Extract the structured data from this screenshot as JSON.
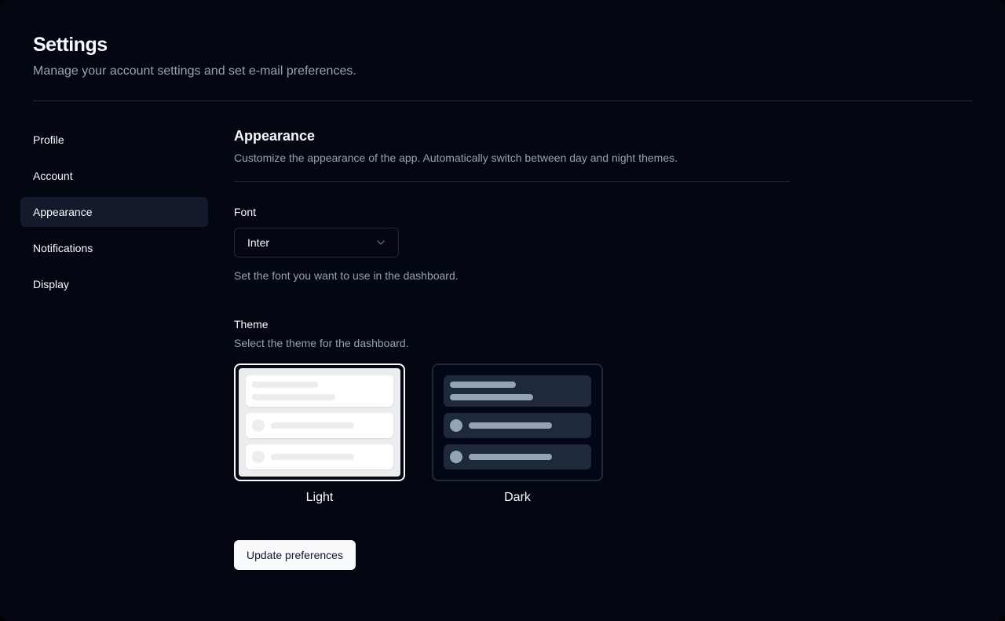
{
  "page": {
    "title": "Settings",
    "subtitle": "Manage your account settings and set e-mail preferences."
  },
  "sidebar": {
    "items": [
      {
        "label": "Profile",
        "active": false
      },
      {
        "label": "Account",
        "active": false
      },
      {
        "label": "Appearance",
        "active": true
      },
      {
        "label": "Notifications",
        "active": false
      },
      {
        "label": "Display",
        "active": false
      }
    ]
  },
  "main": {
    "heading": "Appearance",
    "description": "Customize the appearance of the app. Automatically switch between day and night themes.",
    "font_field": {
      "label": "Font",
      "value": "Inter",
      "helper": "Set the font you want to use in the dashboard.",
      "icon": "chevron-down"
    },
    "theme_field": {
      "label": "Theme",
      "description": "Select the theme for the dashboard.",
      "options": [
        {
          "label": "Light",
          "selected": true
        },
        {
          "label": "Dark",
          "selected": false
        }
      ]
    },
    "submit_label": "Update preferences"
  },
  "colors": {
    "page_bg": "#030711",
    "text": "#f8fafc",
    "muted_text": "#94a3b8",
    "border": "#1e293b",
    "active_item_bg": "#131a2b",
    "selected_ring": "#f8fafc",
    "light_panel": "#ecedef",
    "dark_panel": "#020617",
    "dark_card": "#1e293b",
    "dark_skeleton": "#94a3b8",
    "button_bg": "#f8fafc",
    "button_text": "#0f172a"
  }
}
